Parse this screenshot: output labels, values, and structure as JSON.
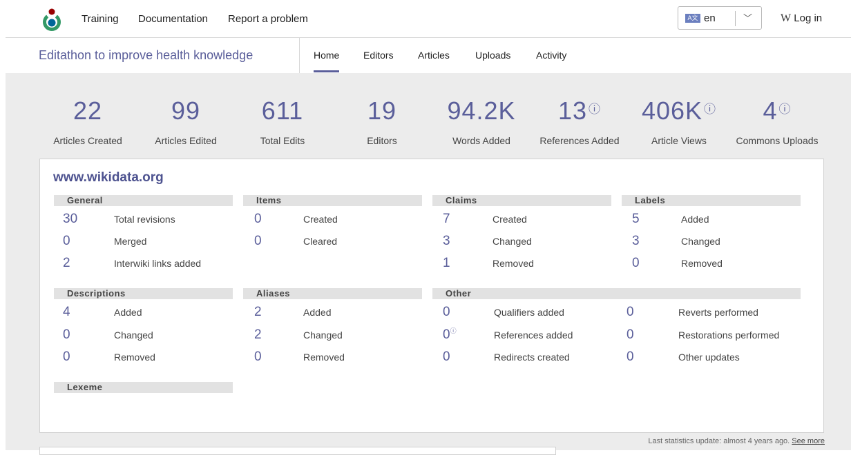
{
  "topnav": {
    "links": [
      "Training",
      "Documentation",
      "Report a problem"
    ],
    "language": "en",
    "login": "Log in"
  },
  "subnav": {
    "event_title": "Editathon to improve health knowledge",
    "tabs": [
      "Home",
      "Editors",
      "Articles",
      "Uploads",
      "Activity"
    ],
    "active_tab": "Home"
  },
  "stats": [
    {
      "value": "22",
      "label": "Articles Created",
      "info": false
    },
    {
      "value": "99",
      "label": "Articles Edited",
      "info": false
    },
    {
      "value": "611",
      "label": "Total Edits",
      "info": false
    },
    {
      "value": "19",
      "label": "Editors",
      "info": false
    },
    {
      "value": "94.2K",
      "label": "Words Added",
      "info": false
    },
    {
      "value": "13",
      "label": "References Added",
      "info": true
    },
    {
      "value": "406K",
      "label": "Article Views",
      "info": true
    },
    {
      "value": "4",
      "label": "Commons Uploads",
      "info": true
    }
  ],
  "wiki": {
    "title": "www.wikidata.org",
    "sections": {
      "general": {
        "heading": "General",
        "rows": [
          [
            "30",
            "Total revisions"
          ],
          [
            "0",
            "Merged"
          ],
          [
            "2",
            "Interwiki links added"
          ]
        ]
      },
      "items": {
        "heading": "Items",
        "rows": [
          [
            "0",
            "Created"
          ],
          [
            "0",
            "Cleared"
          ]
        ]
      },
      "claims": {
        "heading": "Claims",
        "rows": [
          [
            "7",
            "Created"
          ],
          [
            "3",
            "Changed"
          ],
          [
            "1",
            "Removed"
          ]
        ]
      },
      "labels": {
        "heading": "Labels",
        "rows": [
          [
            "5",
            "Added"
          ],
          [
            "3",
            "Changed"
          ],
          [
            "0",
            "Removed"
          ]
        ]
      },
      "descriptions": {
        "heading": "Descriptions",
        "rows": [
          [
            "4",
            "Added"
          ],
          [
            "0",
            "Changed"
          ],
          [
            "0",
            "Removed"
          ]
        ]
      },
      "aliases": {
        "heading": "Aliases",
        "rows": [
          [
            "2",
            "Added"
          ],
          [
            "2",
            "Changed"
          ],
          [
            "0",
            "Removed"
          ]
        ]
      },
      "other": {
        "heading": "Other",
        "rows": [
          [
            "0",
            "Qualifiers added"
          ],
          [
            "0",
            "References added"
          ],
          [
            "0",
            "Redirects created"
          ]
        ]
      },
      "other2": {
        "rows": [
          [
            "0",
            "Reverts performed"
          ],
          [
            "0",
            "Restorations performed"
          ],
          [
            "0",
            "Other updates"
          ]
        ]
      },
      "lexeme": {
        "heading": "Lexeme"
      }
    }
  },
  "footer": {
    "note": "Last statistics update: almost 4 years ago.",
    "link": "See more"
  },
  "info_glyph": "ⓘ",
  "colors": {
    "accent": "#5a5e9a",
    "grey_bg": "#ececec"
  }
}
